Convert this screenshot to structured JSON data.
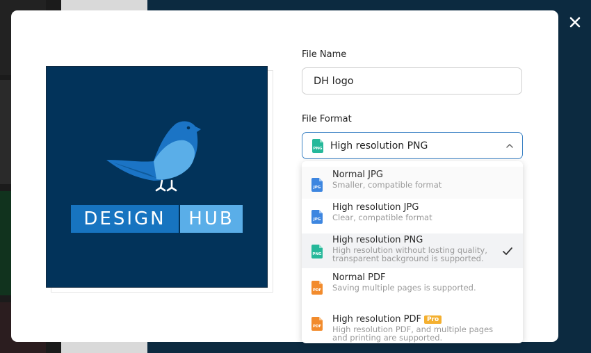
{
  "dialog": {
    "file_name_label": "File Name",
    "file_name_value": "DH logo",
    "file_format_label": "File Format",
    "selected_format": "High resolution PNG",
    "close_icon": "close-icon"
  },
  "preview": {
    "logo_word_1": "DESIGN",
    "logo_word_2": "HUB"
  },
  "formats": [
    {
      "title": "Normal JPG",
      "desc": "Smaller, compatible format",
      "icon": "JPG",
      "color": "#3d86e0"
    },
    {
      "title": "High resolution JPG",
      "desc": "Clear, compatible format",
      "icon": "JPG",
      "color": "#3d86e0"
    },
    {
      "title": "High resolution PNG",
      "desc_1": "High resolution without losting quality,",
      "desc_2": "transparent background is supported.",
      "icon": "PNG",
      "color": "#26b89a"
    },
    {
      "title": "Normal PDF",
      "desc": "Saving multiple pages is supported.",
      "icon": "PDF",
      "color": "#f28b2c"
    },
    {
      "title": "High resolution PDF",
      "badge": "Pro",
      "desc_1": "High resolution PDF, and multiple pages",
      "desc_2": "and printing are supported.",
      "icon": "PDF",
      "color": "#f28b2c"
    }
  ],
  "colors": {
    "accent": "#3b82c4",
    "preview_bg": "#02335a",
    "pro_badge": "#f4b030"
  }
}
